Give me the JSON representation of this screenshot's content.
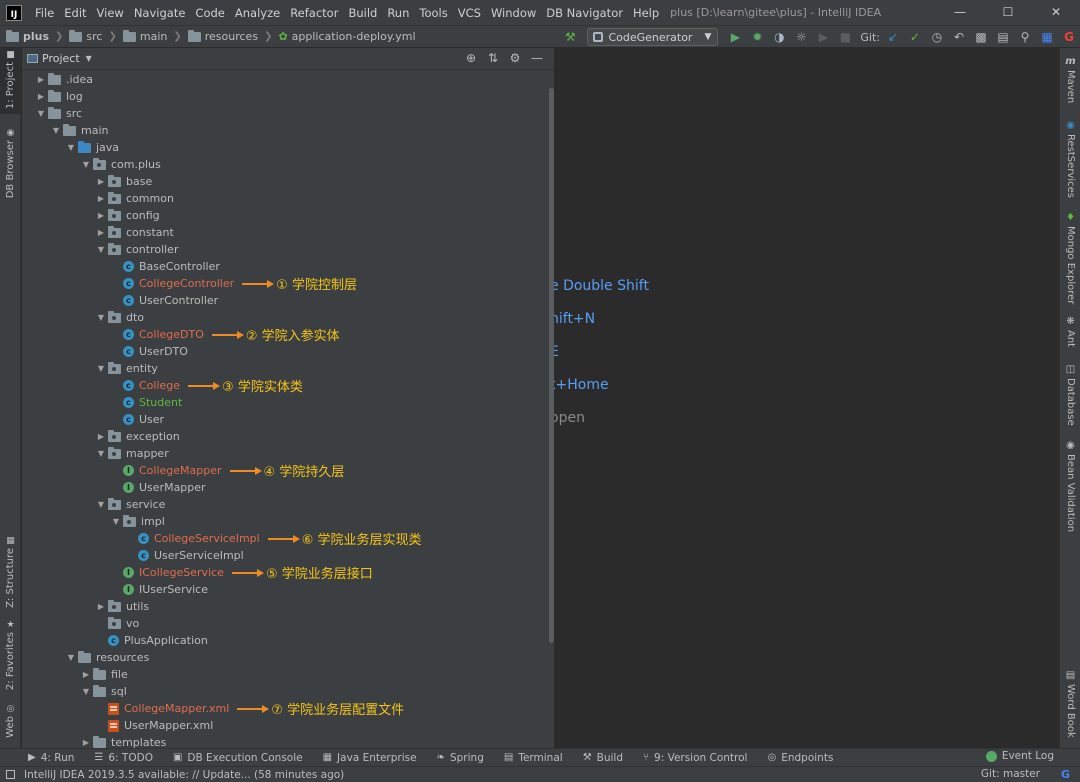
{
  "menubar": {
    "items": [
      "File",
      "Edit",
      "View",
      "Navigate",
      "Code",
      "Analyze",
      "Refactor",
      "Build",
      "Run",
      "Tools",
      "VCS",
      "Window",
      "DB Navigator",
      "Help"
    ],
    "title": "plus [D:\\learn\\gitee\\plus] - IntelliJ IDEA",
    "controls": [
      "—",
      "☐",
      "✕"
    ]
  },
  "breadcrumb": {
    "items": [
      "plus",
      "src",
      "main",
      "resources",
      "application-deploy.yml"
    ]
  },
  "toolbar": {
    "run_config": "CodeGenerator",
    "git_label": "Git:",
    "icons": [
      "hammer-icon",
      "run-icon",
      "debug-icon",
      "coverage-icon",
      "profile-icon",
      "stop-icon",
      "git-update-icon",
      "git-commit-icon",
      "history-icon",
      "rollback-icon",
      "project-structure-icon",
      "layout-icon",
      "search-icon",
      "translate-icon",
      "google-icon"
    ]
  },
  "left_strip": {
    "tabs": [
      "1: Project",
      "DB Browser",
      "Z: Structure",
      "2: Favorites",
      "Web"
    ]
  },
  "right_strip": {
    "tabs": [
      "Maven",
      "RestServices",
      "Mongo Explorer",
      "Ant",
      "Database",
      "Bean Validation",
      "Word Book"
    ]
  },
  "project_panel": {
    "title": "Project"
  },
  "tree": [
    {
      "label": ".idea",
      "kind": "folder",
      "depth": 1,
      "arrow": "right"
    },
    {
      "label": "log",
      "kind": "folder",
      "depth": 1,
      "arrow": "right"
    },
    {
      "label": "src",
      "kind": "folder",
      "depth": 1,
      "arrow": "down"
    },
    {
      "label": "main",
      "kind": "folder",
      "depth": 2,
      "arrow": "down"
    },
    {
      "label": "java",
      "kind": "folder-blue",
      "depth": 3,
      "arrow": "down"
    },
    {
      "label": "com.plus",
      "kind": "package",
      "depth": 4,
      "arrow": "down"
    },
    {
      "label": "base",
      "kind": "package",
      "depth": 5,
      "arrow": "right"
    },
    {
      "label": "common",
      "kind": "package",
      "depth": 5,
      "arrow": "right"
    },
    {
      "label": "config",
      "kind": "package",
      "depth": 5,
      "arrow": "right"
    },
    {
      "label": "constant",
      "kind": "package",
      "depth": 5,
      "arrow": "right"
    },
    {
      "label": "controller",
      "kind": "package",
      "depth": 5,
      "arrow": "down"
    },
    {
      "label": "BaseController",
      "kind": "class",
      "depth": 6,
      "arrow": "none"
    },
    {
      "label": "CollegeController",
      "kind": "class",
      "depth": 6,
      "arrow": "none",
      "color": "red",
      "annotation": "① 学院控制层"
    },
    {
      "label": "UserController",
      "kind": "class",
      "depth": 6,
      "arrow": "none"
    },
    {
      "label": "dto",
      "kind": "package",
      "depth": 5,
      "arrow": "down"
    },
    {
      "label": "CollegeDTO",
      "kind": "class",
      "depth": 6,
      "arrow": "none",
      "color": "red",
      "annotation": "② 学院入参实体"
    },
    {
      "label": "UserDTO",
      "kind": "class",
      "depth": 6,
      "arrow": "none"
    },
    {
      "label": "entity",
      "kind": "package",
      "depth": 5,
      "arrow": "down"
    },
    {
      "label": "College",
      "kind": "class",
      "depth": 6,
      "arrow": "none",
      "color": "red",
      "annotation": "③ 学院实体类"
    },
    {
      "label": "Student",
      "kind": "class",
      "depth": 6,
      "arrow": "none",
      "color": "green"
    },
    {
      "label": "User",
      "kind": "class",
      "depth": 6,
      "arrow": "none"
    },
    {
      "label": "exception",
      "kind": "package",
      "depth": 5,
      "arrow": "right"
    },
    {
      "label": "mapper",
      "kind": "package",
      "depth": 5,
      "arrow": "down"
    },
    {
      "label": "CollegeMapper",
      "kind": "interface",
      "depth": 6,
      "arrow": "none",
      "color": "red",
      "annotation": "④ 学院持久层"
    },
    {
      "label": "UserMapper",
      "kind": "interface",
      "depth": 6,
      "arrow": "none"
    },
    {
      "label": "service",
      "kind": "package",
      "depth": 5,
      "arrow": "down"
    },
    {
      "label": "impl",
      "kind": "package",
      "depth": 6,
      "arrow": "down"
    },
    {
      "label": "CollegeServiceImpl",
      "kind": "class",
      "depth": 7,
      "arrow": "none",
      "color": "red",
      "annotation": "⑥ 学院业务层实现类"
    },
    {
      "label": "UserServiceImpl",
      "kind": "class",
      "depth": 7,
      "arrow": "none"
    },
    {
      "label": "ICollegeService",
      "kind": "interface",
      "depth": 6,
      "arrow": "none",
      "color": "red",
      "annotation": "⑤ 学院业务层接口"
    },
    {
      "label": "IUserService",
      "kind": "interface",
      "depth": 6,
      "arrow": "none"
    },
    {
      "label": "utils",
      "kind": "package",
      "depth": 5,
      "arrow": "right"
    },
    {
      "label": "vo",
      "kind": "package",
      "depth": 5,
      "arrow": "none"
    },
    {
      "label": "PlusApplication",
      "kind": "class",
      "depth": 5,
      "arrow": "none"
    },
    {
      "label": "resources",
      "kind": "folder",
      "depth": 3,
      "arrow": "down"
    },
    {
      "label": "file",
      "kind": "folder",
      "depth": 4,
      "arrow": "right"
    },
    {
      "label": "sql",
      "kind": "folder",
      "depth": 4,
      "arrow": "down"
    },
    {
      "label": "CollegeMapper.xml",
      "kind": "xml",
      "depth": 5,
      "arrow": "none",
      "color": "red",
      "annotation": "⑦ 学院业务层配置文件"
    },
    {
      "label": "UserMapper.xml",
      "kind": "xml",
      "depth": 5,
      "arrow": "none"
    },
    {
      "label": "templates",
      "kind": "folder",
      "depth": 4,
      "arrow": "right"
    }
  ],
  "editor": {
    "hints": [
      {
        "text": "e  Double Shift",
        "style": "blue"
      },
      {
        "text": "hift+N",
        "style": "blue"
      },
      {
        "text": "E",
        "style": "blue"
      },
      {
        "text": "t+Home",
        "style": "blue"
      },
      {
        "text": "open",
        "style": "gray"
      }
    ]
  },
  "bottom_bar": {
    "tabs": [
      {
        "label": "4: Run",
        "icon": "run-icon"
      },
      {
        "label": "6: TODO",
        "icon": "todo-icon"
      },
      {
        "label": "DB Execution Console",
        "icon": "db-console-icon"
      },
      {
        "label": "Java Enterprise",
        "icon": "java-enterprise-icon"
      },
      {
        "label": "Spring",
        "icon": "spring-icon"
      },
      {
        "label": "Terminal",
        "icon": "terminal-icon"
      },
      {
        "label": "Build",
        "icon": "build-icon"
      },
      {
        "label": "9: Version Control",
        "icon": "version-control-icon"
      },
      {
        "label": "Endpoints",
        "icon": "endpoints-icon"
      }
    ],
    "event_log": "Event Log"
  },
  "status_bar": {
    "message": "IntelliJ IDEA 2019.3.5 available: // Update... (58 minutes ago)",
    "git_branch": "Git: master"
  }
}
